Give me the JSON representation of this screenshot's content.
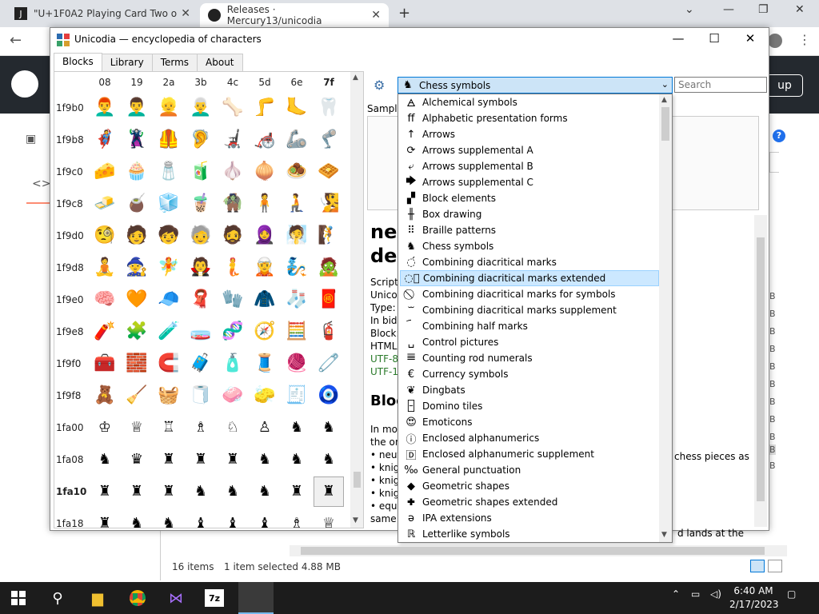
{
  "browser": {
    "tab1_title": "\"U+1F0A2 Playing Card Two o",
    "tab2_title": "Releases · Mercury13/unicodia",
    "new_tab": "+",
    "gh_signup": "up"
  },
  "app": {
    "title": "Unicodia — encyclopedia of characters",
    "tabs": [
      "Blocks",
      "Library",
      "Terms",
      "About"
    ],
    "col_headers": [
      "08",
      "19",
      "2a",
      "3b",
      "4c",
      "5d",
      "6e",
      "7f"
    ],
    "row_headers": [
      "1f9b0",
      "1f9b8",
      "1f9c0",
      "1f9c8",
      "1f9d0",
      "1f9d8",
      "1f9e0",
      "1f9e8",
      "1f9f0",
      "1f9f8",
      "1fa00",
      "1fa08",
      "1fa10",
      "1fa18"
    ],
    "grid": [
      [
        "👨‍🦰",
        "👨‍🦱",
        "👱",
        "👨‍🦳",
        "🦴",
        "🦵",
        "🦶",
        "🦷"
      ],
      [
        "🦸",
        "🦹",
        "🦺",
        "🦻",
        "🦼",
        "🦽",
        "🦾",
        "🦿"
      ],
      [
        "🧀",
        "🧁",
        "🧂",
        "🧃",
        "🧄",
        "🧅",
        "🧆",
        "🧇"
      ],
      [
        "🧈",
        "🧉",
        "🧊",
        "🧋",
        "🧌",
        "🧍",
        "🧎",
        "🧏"
      ],
      [
        "🧐",
        "🧑",
        "🧒",
        "🧓",
        "🧔",
        "🧕",
        "🧖",
        "🧗"
      ],
      [
        "🧘",
        "🧙",
        "🧚",
        "🧛",
        "🧜",
        "🧝",
        "🧞",
        "🧟"
      ],
      [
        "🧠",
        "🧡",
        "🧢",
        "🧣",
        "🧤",
        "🧥",
        "🧦",
        "🧧"
      ],
      [
        "🧨",
        "🧩",
        "🧪",
        "🧫",
        "🧬",
        "🧭",
        "🧮",
        "🧯"
      ],
      [
        "🧰",
        "🧱",
        "🧲",
        "🧳",
        "🧴",
        "🧵",
        "🧶",
        "🧷"
      ],
      [
        "🧸",
        "🧹",
        "🧺",
        "🧻",
        "🧼",
        "🧽",
        "🧾",
        "🧿"
      ],
      [
        "♔",
        "♕",
        "♖",
        "♗",
        "♘",
        "♙",
        "♞",
        "♞"
      ],
      [
        "♞",
        "♛",
        "♜",
        "♜",
        "♜",
        "♞",
        "♞",
        "♞"
      ],
      [
        "♜",
        "♜",
        "♜",
        "♞",
        "♞",
        "♞",
        "♜",
        "♜"
      ],
      [
        "♜",
        "♞",
        "♞",
        "♝",
        "♝",
        "♝",
        "♗",
        "♕"
      ]
    ],
    "search_placeholder": "Search",
    "combo_value": "Chess symbols",
    "combo_icon": "chess-piece-icon",
    "dropdown": [
      {
        "label": "Alchemical symbols",
        "icon": "🜁"
      },
      {
        "label": "Alphabetic presentation forms",
        "icon": "ﬀ"
      },
      {
        "label": "Arrows",
        "icon": "↑"
      },
      {
        "label": "Arrows supplemental A",
        "icon": "⟳"
      },
      {
        "label": "Arrows supplemental B",
        "icon": "⤶"
      },
      {
        "label": "Arrows supplemental C",
        "icon": "🡆"
      },
      {
        "label": "Block elements",
        "icon": "▞"
      },
      {
        "label": "Box drawing",
        "icon": "╫"
      },
      {
        "label": "Braille patterns",
        "icon": "⠿"
      },
      {
        "label": "Chess symbols",
        "icon": "♞"
      },
      {
        "label": "Combining diacritical marks",
        "icon": "◌́"
      },
      {
        "label": "Combining diacritical marks extended",
        "icon": "◌᪰"
      },
      {
        "label": "Combining diacritical marks for symbols",
        "icon": "⃠"
      },
      {
        "label": "Combining diacritical marks supplement",
        "icon": "ᷓ"
      },
      {
        "label": "Combining half marks",
        "icon": "︠"
      },
      {
        "label": "Control pictures",
        "icon": "␣"
      },
      {
        "label": "Counting rod numerals",
        "icon": "𝍣"
      },
      {
        "label": "Currency symbols",
        "icon": "€"
      },
      {
        "label": "Dingbats",
        "icon": "❦"
      },
      {
        "label": "Domino tiles",
        "icon": "🁣"
      },
      {
        "label": "Emoticons",
        "icon": "😍"
      },
      {
        "label": "Enclosed alphanumerics",
        "icon": "ⓘ"
      },
      {
        "label": "Enclosed alphanumeric supplement",
        "icon": "🄳"
      },
      {
        "label": "General punctuation",
        "icon": "‰"
      },
      {
        "label": "Geometric shapes",
        "icon": "◆"
      },
      {
        "label": "Geometric shapes extended",
        "icon": "🞧"
      },
      {
        "label": "IPA extensions",
        "icon": "ə"
      },
      {
        "label": "Letterlike symbols",
        "icon": "ℝ"
      }
    ],
    "highlighted_index": 11,
    "sample_label": "Sample",
    "char_title_1": "neu",
    "char_title_2": "deg",
    "info": [
      "Script:",
      "Unicod",
      "Type: S",
      "In bidi",
      "Block:",
      "HTML:",
      "UTF-8",
      "UTF-16"
    ],
    "blocks_heading": "Bloc",
    "desc": [
      "In mov",
      "the on",
      "• neut",
      "• knig",
      "• knig",
      "• knig",
      "• equi",
      "same c"
    ],
    "desc_right": [
      "chess pieces as",
      "d lands at the",
      "uares from start to"
    ]
  },
  "explorer": {
    "items": "16 items",
    "selected": "1 item selected  4.88 MB",
    "side_b": "B"
  },
  "taskbar": {
    "time": "6:40 AM",
    "date": "2/17/2023"
  }
}
